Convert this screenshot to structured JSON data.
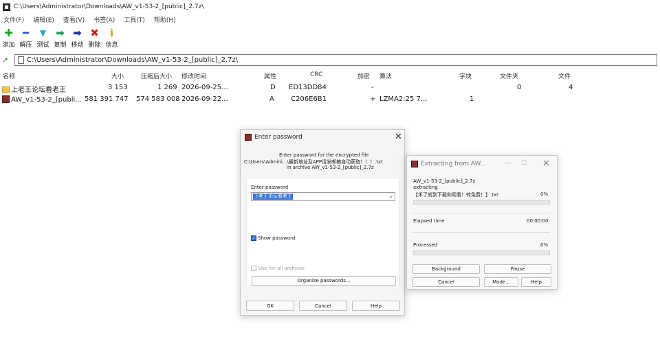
{
  "window": {
    "title": "C:\\Users\\Administrator\\Downloads\\AW_v1-53-2_[public]_2.7z\\"
  },
  "menu": [
    "文件(F)",
    "编辑(E)",
    "查看(V)",
    "书签(A)",
    "工具(T)",
    "帮助(H)"
  ],
  "toolbar": [
    {
      "label": "添加",
      "icon": "add-icon",
      "glyph": "✚",
      "color": "#1fa31f"
    },
    {
      "label": "解压",
      "icon": "extract-icon",
      "glyph": "━",
      "color": "#2d4fc4"
    },
    {
      "label": "测试",
      "icon": "test-icon",
      "glyph": "▼",
      "color": "#2aa7c9"
    },
    {
      "label": "复制",
      "icon": "copy-icon",
      "glyph": "➡",
      "color": "#1f9a55"
    },
    {
      "label": "移动",
      "icon": "move-icon",
      "glyph": "➡",
      "color": "#1e35a5"
    },
    {
      "label": "删除",
      "icon": "delete-icon",
      "glyph": "✖",
      "color": "#d01d1d"
    },
    {
      "label": "信息",
      "icon": "info-icon",
      "glyph": "ℹ",
      "color": "#c9a21a"
    }
  ],
  "address": "C:\\Users\\Administrator\\Downloads\\AW_v1-53-2_[public]_2.7z\\",
  "columns": {
    "name": "名称",
    "size": "大小",
    "packed": "压缩后大小",
    "modified": "修改时间",
    "attr": "属性",
    "crc": "CRC",
    "encrypted": "加密",
    "method": "算法",
    "block": "字块",
    "folders": "文件夹",
    "files": "文件"
  },
  "rows": [
    {
      "name": "上老王论坛看老王",
      "size": "3 153",
      "packed": "1 269",
      "modified": "2026-09-25...",
      "attr": "D",
      "crc": "ED13DD84",
      "encrypted": "-",
      "method": "",
      "block": "",
      "folders": "0",
      "files": "4"
    },
    {
      "name": "AW_v1-53-2_[publi...",
      "size": "581 391 747",
      "packed": "574 583 008",
      "modified": "2026-09-22...",
      "attr": "A",
      "crc": "C206E6B1",
      "encrypted": "+",
      "method": "LZMA2:25 7...",
      "block": "1",
      "folders": "",
      "files": ""
    }
  ],
  "password_dialog": {
    "title": "Enter password",
    "msg1": "Enter password for the encrypted file",
    "msg2": "C:\\Users\\Admini...\\最新地址及APP请发邮箱自动获取！！！.txt",
    "msg3": "in archive AW_v1-53-2_[public]_2.7z",
    "field_label": "Enter password",
    "password_value": "上老王论坛看老王",
    "show_password": "Show password",
    "use_all": "Use for all archives",
    "organize": "Organize passwords...",
    "ok": "OK",
    "cancel": "Cancel",
    "help": "Help"
  },
  "extract_dialog": {
    "title": "Extracting from AW...",
    "archive": "AW_v1-53-2_[public]_2.7z",
    "status": "extracting",
    "file": "【禾了就到下载和观看！转免费！】.txt",
    "file_percent": "0%",
    "elapsed_label": "Elapsed time",
    "elapsed_value": "00:00:00",
    "processed_label": "Processed",
    "processed_percent": "0%",
    "background": "Background",
    "pause": "Pause",
    "cancel": "Cancel",
    "mode": "Mode...",
    "help": "Help"
  }
}
